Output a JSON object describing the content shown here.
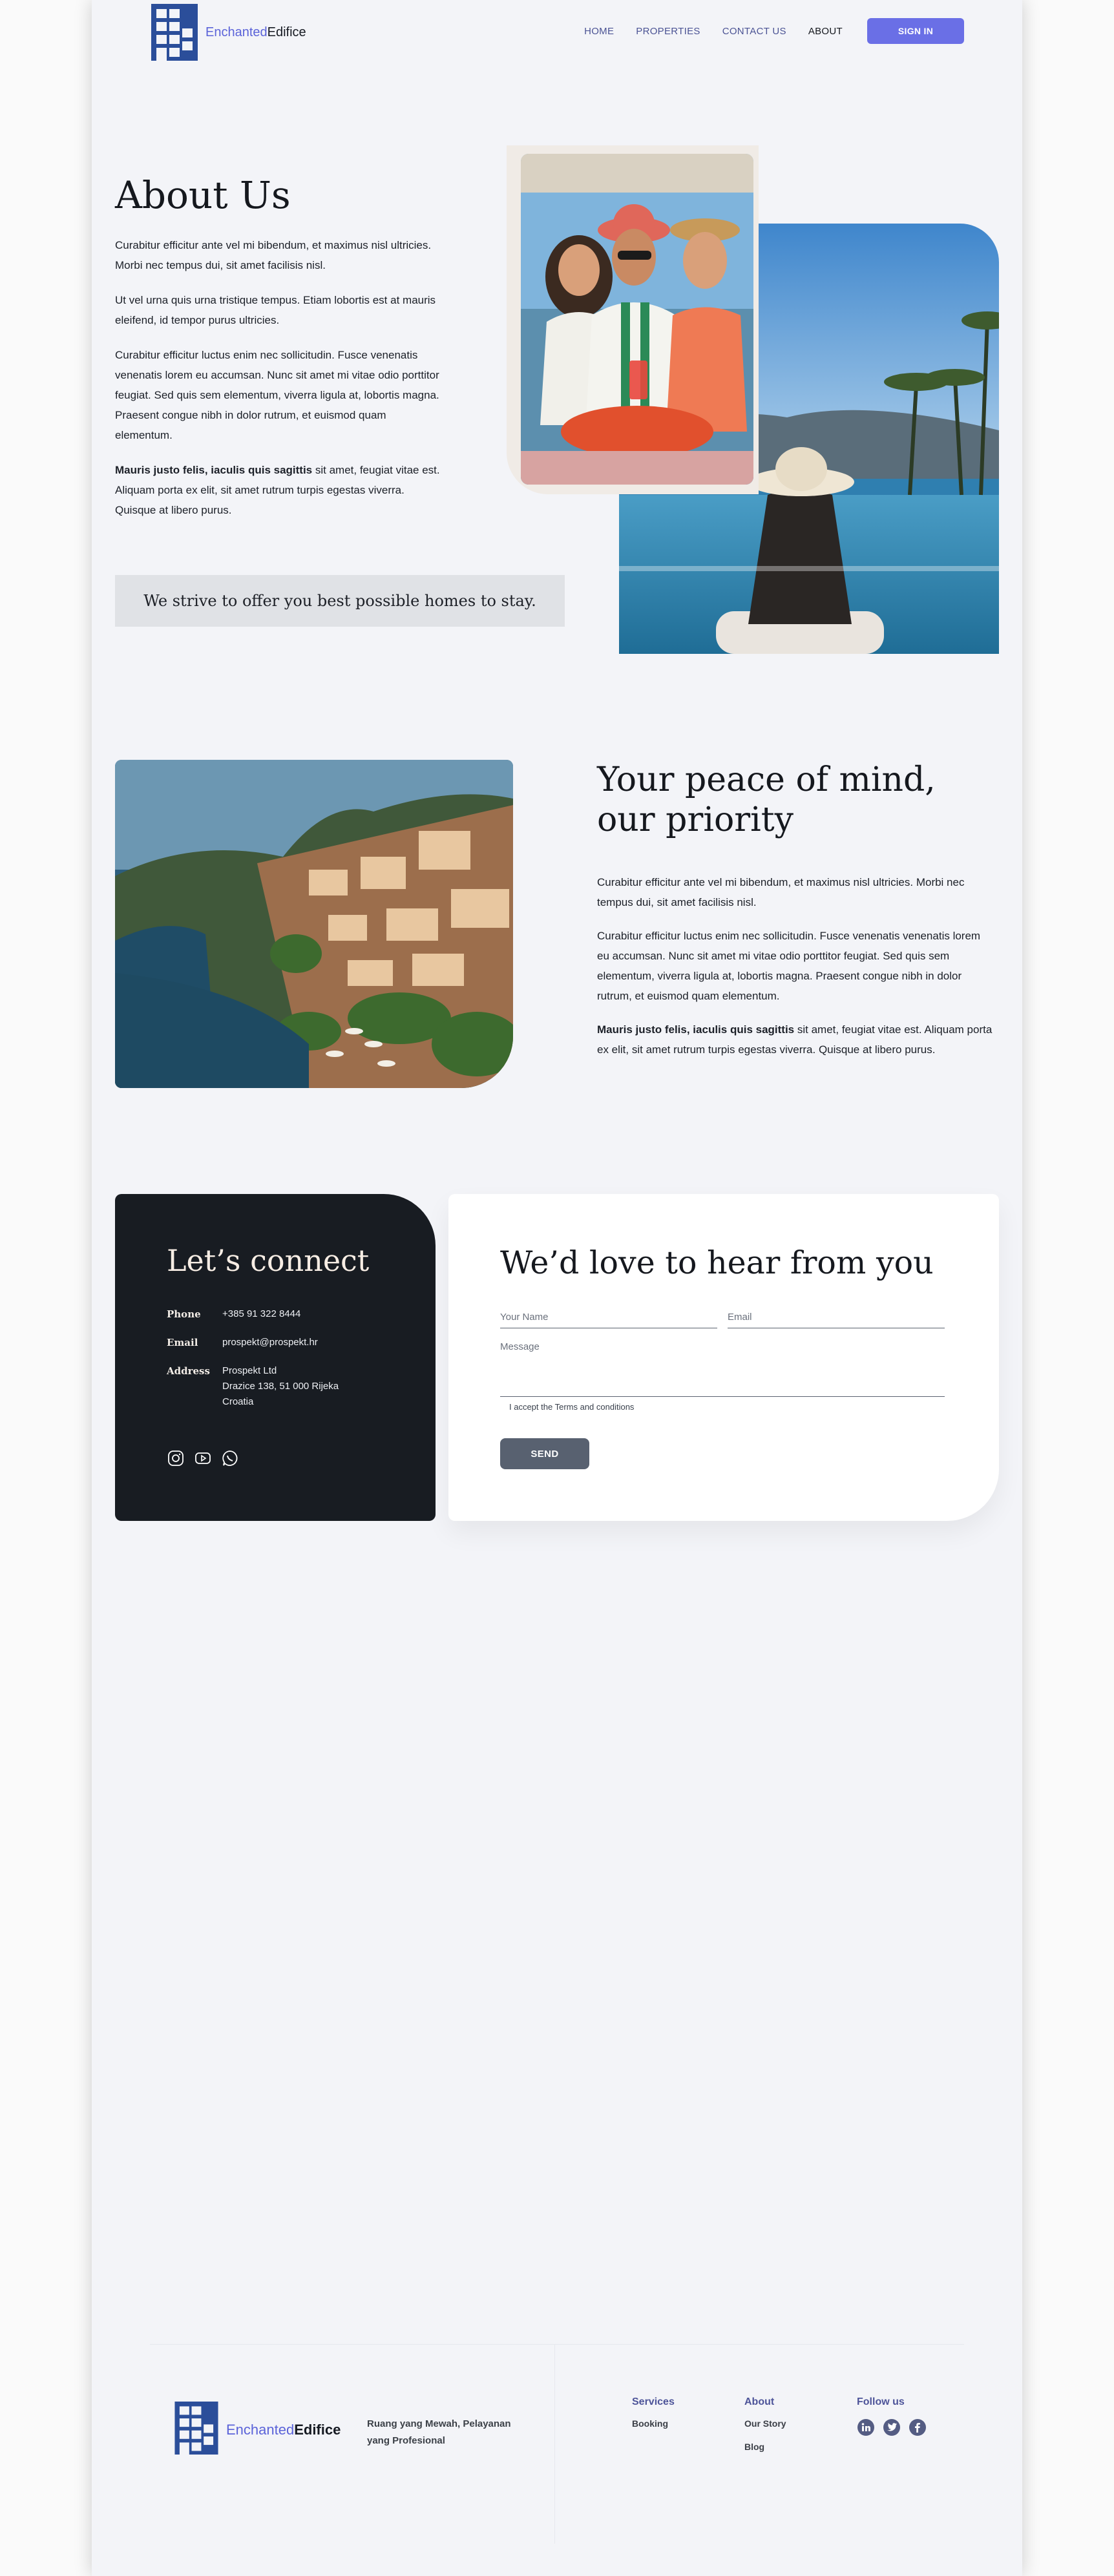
{
  "brand": {
    "name_part1": "Enchanted",
    "name_part2": "Edifice"
  },
  "nav": {
    "items": [
      {
        "label": "HOME",
        "active": false
      },
      {
        "label": "PROPERTIES",
        "active": false
      },
      {
        "label": "CONTACT US",
        "active": false
      },
      {
        "label": "ABOUT",
        "active": true
      }
    ],
    "signin_label": "SIGN IN"
  },
  "about": {
    "title": "About Us",
    "p1": "Curabitur efficitur ante vel mi bibendum, et maximus nisl ultricies. Morbi nec tempus dui, sit amet facilisis nisl.",
    "p2": "Ut vel urna quis urna tristique tempus. Etiam lobortis est at mauris eleifend, id tempor purus ultricies.",
    "p3": "Curabitur efficitur luctus enim nec sollicitudin. Fusce venenatis venenatis lorem eu accumsan. Nunc sit amet mi vitae odio porttitor feugiat. Sed quis sem elementum, viverra ligula at, lobortis magna. Praesent congue nibh in dolor rutrum, et euismod quam elementum.",
    "p4_bold": "Mauris justo felis, iaculis quis sagittis",
    "p4_rest": " sit amet, feugiat vitae est. Aliquam porta ex elit, sit amet rutrum turpis egestas viverra. Quisque at libero purus.",
    "strive": "We strive to offer you best possible homes to stay."
  },
  "peace": {
    "title_line1": "Your peace of mind,",
    "title_line2": "our priority",
    "p1": "Curabitur efficitur ante vel mi bibendum, et maximus nisl ultricies. Morbi nec tempus dui, sit amet facilisis nisl.",
    "p2": "Curabitur efficitur luctus enim nec sollicitudin. Fusce venenatis venenatis lorem eu accumsan. Nunc sit amet mi vitae odio porttitor feugiat. Sed quis sem elementum, viverra ligula at, lobortis magna. Praesent congue nibh in dolor rutrum, et euismod quam elementum.",
    "p3_bold": "Mauris justo felis, iaculis quis sagittis",
    "p3_rest": " sit amet, feugiat vitae est. Aliquam porta ex elit, sit amet rutrum turpis egestas viverra. Quisque at libero purus."
  },
  "connect": {
    "title": "Let’s connect",
    "phone_label": "Phone",
    "phone": "+385 91 322 8444",
    "email_label": "Email",
    "email": "prospekt@prospekt.hr",
    "address_label": "Address",
    "address_l1": "Prospekt Ltd",
    "address_l2": "Drazice 138, 51 000 Rijeka",
    "address_l3": "Croatia",
    "socials": [
      "instagram-icon",
      "youtube-icon",
      "whatsapp-icon"
    ]
  },
  "form": {
    "title": "We’d love to hear from you",
    "name_placeholder": "Your Name",
    "email_placeholder": "Email",
    "message_placeholder": "Message",
    "terms": "I accept the Terms and conditions",
    "send_label": "SEND"
  },
  "footer": {
    "tagline": "Ruang yang Mewah, Pelayanan yang Profesional",
    "services_head": "Services",
    "services": [
      "Booking"
    ],
    "about_head": "About",
    "about_links": [
      "Our Story",
      "Blog"
    ],
    "follow_head": "Follow us",
    "follow": [
      "linkedin-icon",
      "twitter-icon",
      "facebook-icon"
    ]
  },
  "colors": {
    "accent": "#6a6fe6",
    "brand_blue": "#2b4e9a",
    "dark_card": "#181c22",
    "button_gray": "#586170"
  }
}
